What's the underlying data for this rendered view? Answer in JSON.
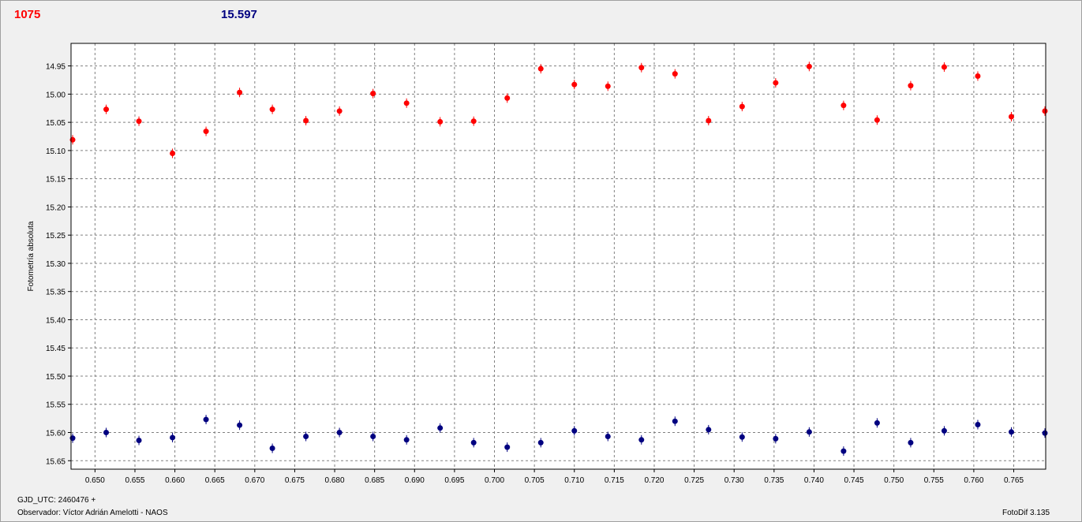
{
  "header": {
    "left_value": "1075",
    "right_value": "15.597"
  },
  "footer": {
    "gjd": "GJD_UTC: 2460476 +",
    "observer": "Observador: Víctor Adrián Amelotti - NAOS",
    "app": "FotoDif 3.135"
  },
  "colors": {
    "series1": "#ff0000",
    "series2": "#000080",
    "grid": "#808080",
    "background": "#ffffff"
  },
  "chart_data": {
    "type": "scatter",
    "ylabel": "Fotometría absoluta",
    "xlabel": "",
    "xlim": [
      0.647,
      0.769
    ],
    "ylim": [
      14.91,
      15.665
    ],
    "y_inverted": true,
    "grid": true,
    "x_ticks": [
      "0.650",
      "0.655",
      "0.660",
      "0.665",
      "0.670",
      "0.675",
      "0.680",
      "0.685",
      "0.690",
      "0.695",
      "0.700",
      "0.705",
      "0.710",
      "0.715",
      "0.720",
      "0.725",
      "0.730",
      "0.735",
      "0.740",
      "0.745",
      "0.750",
      "0.755",
      "0.760",
      "0.765"
    ],
    "y_ticks": [
      "14.95",
      "15.00",
      "15.05",
      "15.10",
      "15.15",
      "15.20",
      "15.25",
      "15.30",
      "15.35",
      "15.40",
      "15.45",
      "15.50",
      "15.55",
      "15.60",
      "15.65"
    ],
    "x": [
      0.6472,
      0.6514,
      0.6555,
      0.6597,
      0.6639,
      0.6681,
      0.6722,
      0.6764,
      0.6806,
      0.6848,
      0.689,
      0.6932,
      0.6974,
      0.7016,
      0.7058,
      0.71,
      0.7142,
      0.7184,
      0.7226,
      0.7268,
      0.731,
      0.7352,
      0.7394,
      0.7437,
      0.7479,
      0.7521,
      0.7563,
      0.7605,
      0.7647,
      0.7689
    ],
    "series": [
      {
        "values": [
          15.081,
          15.027,
          15.048,
          15.105,
          15.066,
          14.997,
          15.027,
          15.047,
          15.03,
          14.999,
          15.016,
          15.049,
          15.048,
          15.007,
          14.955,
          14.983,
          14.986,
          14.953,
          14.964,
          15.047,
          15.022,
          14.98,
          14.951,
          15.02,
          15.046,
          14.985,
          14.952,
          14.968,
          15.04,
          15.03
        ]
      },
      {
        "values": [
          15.61,
          15.6,
          15.614,
          15.609,
          15.577,
          15.587,
          15.628,
          15.607,
          15.6,
          15.607,
          15.613,
          15.592,
          15.618,
          15.626,
          15.618,
          15.597,
          15.607,
          15.613,
          15.58,
          15.595,
          15.608,
          15.611,
          15.599,
          15.633,
          15.583,
          15.618,
          15.597,
          15.586,
          15.599,
          15.601
        ]
      }
    ]
  }
}
